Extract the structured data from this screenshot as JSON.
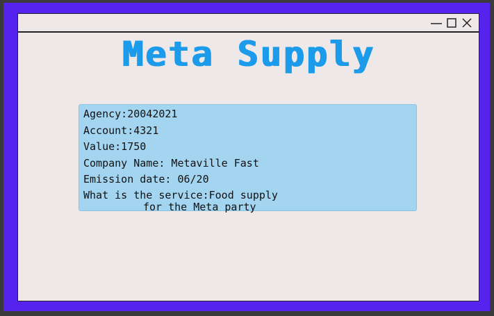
{
  "app": {
    "title": "Meta Supply"
  },
  "window_controls": {
    "icons": [
      "minimize-icon",
      "maximize-icon",
      "close-icon"
    ]
  },
  "details": {
    "agency": "Agency:20042021",
    "account": "Account:4321",
    "value": "Value:1750",
    "company_name": "Company Name: Metaville Fast",
    "emission_date": "Emission date: 06/20",
    "service_line1": "What is the service:Food supply",
    "service_line2": "for the Meta party"
  },
  "colors": {
    "frame": "#5522ee",
    "window_bg": "#eee8e8",
    "title": "#1b9bea",
    "panel_bg": "#a3d5f1"
  }
}
